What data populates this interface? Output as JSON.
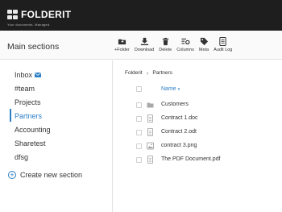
{
  "brand": {
    "name": "FOLDERIT",
    "tagline": "Your documents. Managed."
  },
  "header": {
    "title": "Main sections"
  },
  "toolbar": {
    "add_folder": "+Folder",
    "download": "Download",
    "delete": "Delete",
    "columns": "Columns",
    "meta": "Meta",
    "audit_log": "Audit Log"
  },
  "sidebar": {
    "items": [
      {
        "label": "Inbox"
      },
      {
        "label": "#team"
      },
      {
        "label": "Projects"
      },
      {
        "label": "Partners"
      },
      {
        "label": "Accounting"
      },
      {
        "label": "Sharetest"
      },
      {
        "label": "dfsg"
      }
    ],
    "active": "Partners",
    "create_label": "Create new section"
  },
  "breadcrumb": {
    "root": "Folderit",
    "current": "Partners"
  },
  "list": {
    "column_name": "Name",
    "sort_indicator": "▾",
    "rows": [
      {
        "name": "Customers",
        "type": "folder"
      },
      {
        "name": "Contract 1.doc",
        "type": "document"
      },
      {
        "name": "Contract 2.odt",
        "type": "document"
      },
      {
        "name": "contract 3.png",
        "type": "image"
      },
      {
        "name": "The PDF Document.pdf",
        "type": "document"
      }
    ]
  },
  "colors": {
    "accent": "#2c7fc4",
    "topbar": "#1e1e1e"
  }
}
